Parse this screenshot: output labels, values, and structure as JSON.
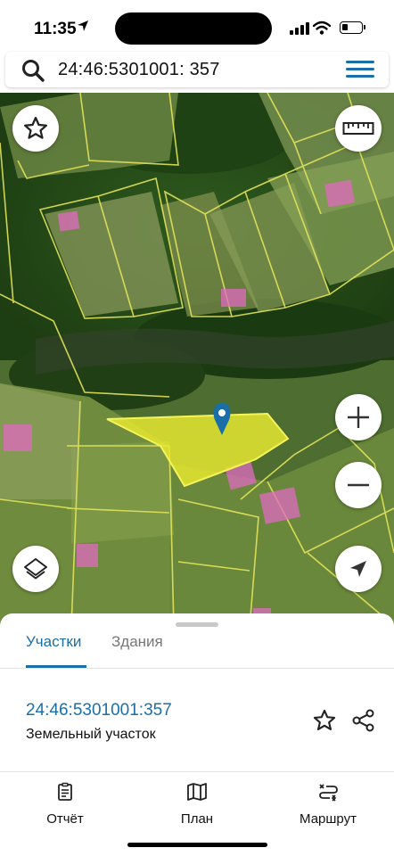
{
  "status": {
    "time": "11:35"
  },
  "search": {
    "query": "24:46:5301001: 357"
  },
  "map": {
    "controls": [
      "favorites-star",
      "ruler",
      "zoom-in",
      "zoom-out",
      "layers",
      "locate"
    ],
    "zoom_in_label": "+",
    "zoom_out_label": "−",
    "highlight_color": "#e6e830",
    "parcel_outline_color": "#e8e83a",
    "building_color": "#e06bc0"
  },
  "sheet": {
    "tabs": [
      {
        "label": "Участки",
        "active": true
      },
      {
        "label": "Здания",
        "active": false
      }
    ],
    "result": {
      "cadastral_number": "24:46:5301001:357",
      "type": "Земельный участок"
    }
  },
  "nav": [
    {
      "label": "Отчёт",
      "icon": "report-icon"
    },
    {
      "label": "План",
      "icon": "map-icon"
    },
    {
      "label": "Маршрут",
      "icon": "route-icon"
    }
  ],
  "colors": {
    "accent": "#1a6fa8"
  }
}
